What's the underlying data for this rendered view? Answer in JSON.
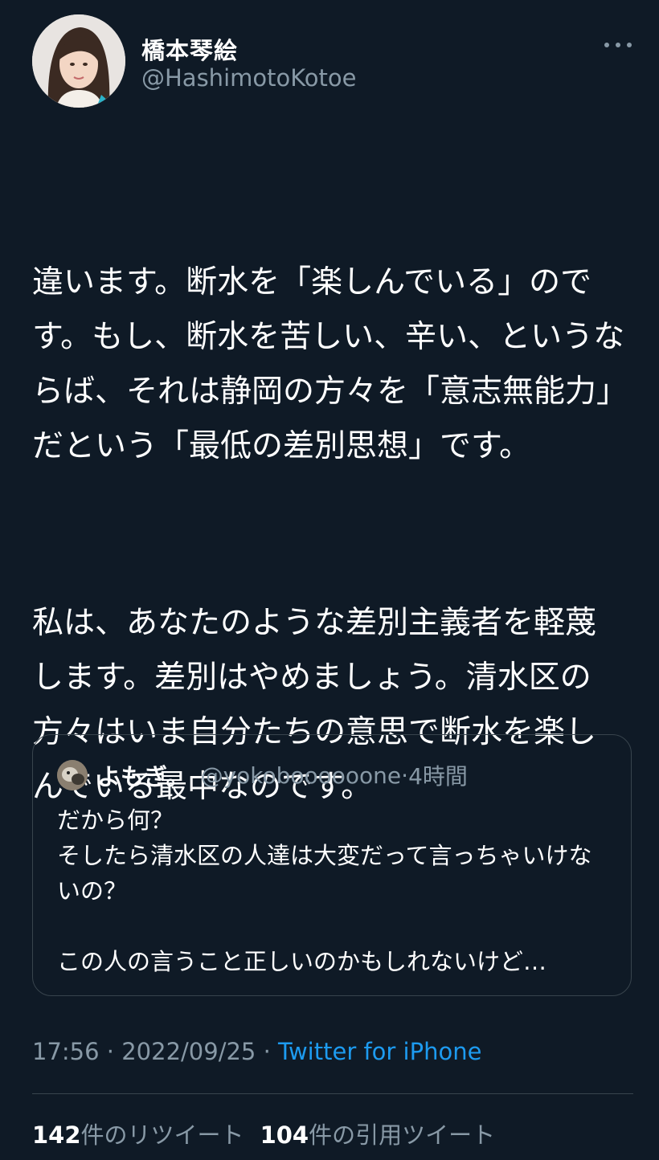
{
  "author": {
    "display_name": "橋本琴絵",
    "handle": "@HashimotoKotoe"
  },
  "tweet": {
    "paragraphs": [
      "違います。断水を「楽しんでいる」のです。もし、断水を苦しい、辛い、というならば、それは静岡の方々を「意志無能力」だという「最低の差別思想」です。",
      "私は、あなたのような差別主義者を軽蔑します。差別はやめましょう。清水区の方々はいま自分たちの意思で断水を楽しんでいる最中なのです。"
    ]
  },
  "quoted_tweet": {
    "name": "よもぎ。",
    "handle": "@yokoboooooone",
    "separator": "·",
    "time": "4時間",
    "text": "だから何？\nそしたら清水区の人達は大変だって言っちゃいけないの？\n\nこの人の言うこと正しいのかもしれないけど…"
  },
  "meta": {
    "time": "17:56",
    "sep1": " · ",
    "date": "2022/09/25",
    "sep2": " · ",
    "source": "Twitter for iPhone"
  },
  "stats": {
    "retweets_count": "142",
    "retweets_label": "件のリツイート",
    "quotes_count": "104",
    "quotes_label": "件の引用ツイート"
  },
  "colors": {
    "background": "#0f1a26",
    "secondary_text": "#8899a6",
    "link": "#1d9bf0",
    "border": "#38444d"
  },
  "icons": {
    "more": "more-horizontal-icon"
  }
}
